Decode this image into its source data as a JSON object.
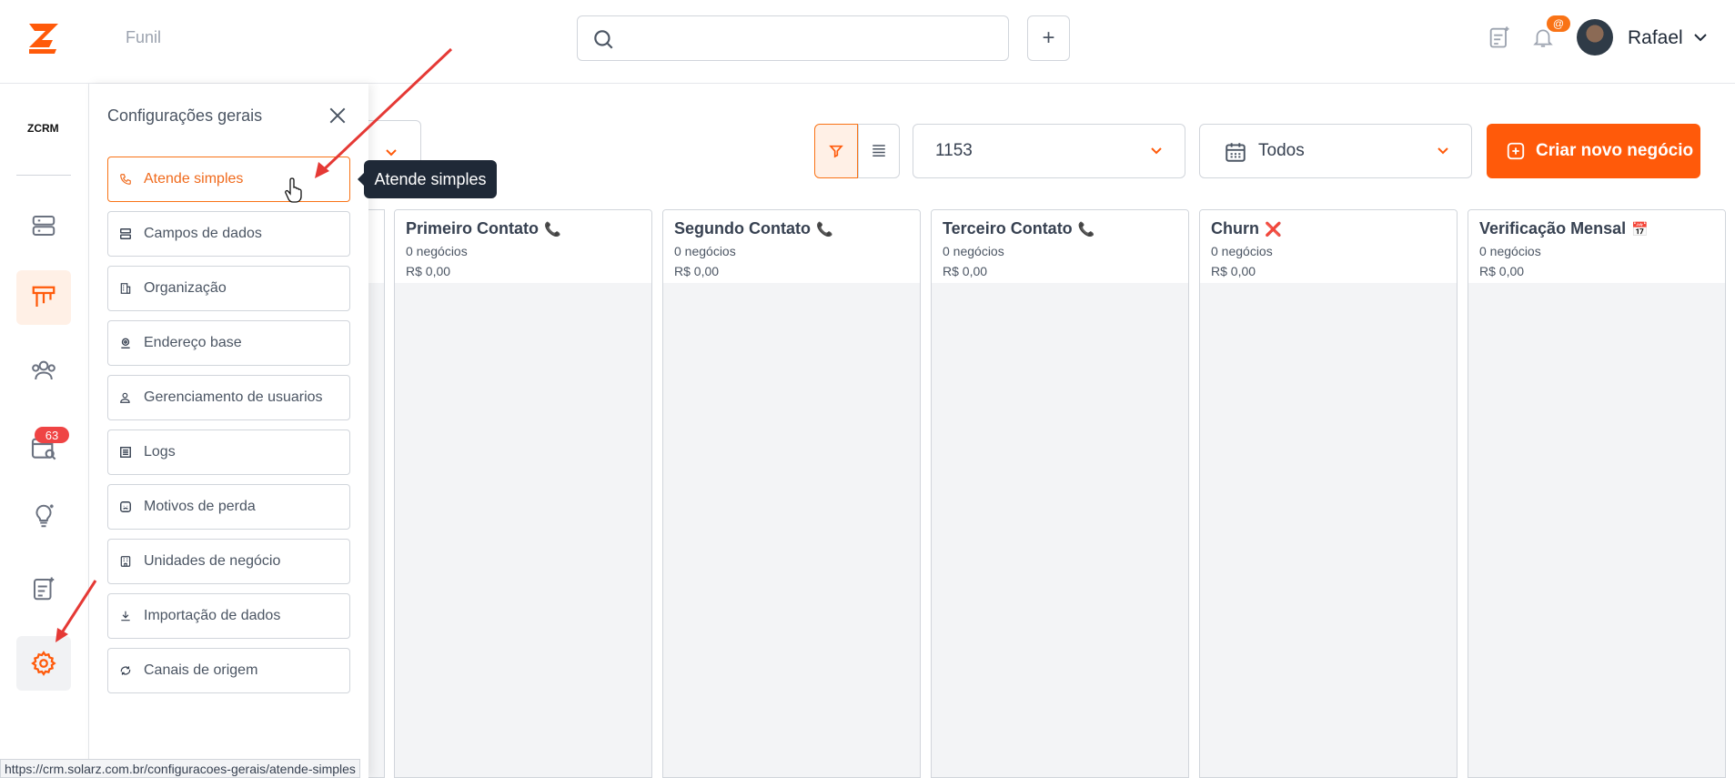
{
  "header": {
    "breadcrumb": "Funil",
    "search_placeholder": "",
    "add_label": "+",
    "mention_badge": "@",
    "user_name": "Rafael"
  },
  "rail": {
    "brand": "ZCRM",
    "notifications_count": "63"
  },
  "settings_panel": {
    "title": "Configurações gerais",
    "items": [
      {
        "label": "Atende simples",
        "icon": "phone-icon",
        "active": true
      },
      {
        "label": "Campos de dados",
        "icon": "database-icon"
      },
      {
        "label": "Organização",
        "icon": "building-icon"
      },
      {
        "label": "Endereço base",
        "icon": "map-pin-icon"
      },
      {
        "label": "Gerenciamento de usuarios",
        "icon": "user-icon"
      },
      {
        "label": "Logs",
        "icon": "list-icon"
      },
      {
        "label": "Motivos de perda",
        "icon": "sad-face-icon"
      },
      {
        "label": "Unidades de negócio",
        "icon": "office-icon"
      },
      {
        "label": "Importação de dados",
        "icon": "download-icon"
      },
      {
        "label": "Canais de origem",
        "icon": "source-channel-icon"
      }
    ]
  },
  "tooltip": "Atende simples",
  "toolbar": {
    "pipeline_value": "1153",
    "period_value": "Todos",
    "create_label": "Criar novo negócio"
  },
  "columns": [
    {
      "title": "Primeiro Contato",
      "emoji": "📞",
      "deals": "0 negócios",
      "value": "R$ 0,00"
    },
    {
      "title": "Segundo Contato",
      "emoji": "📞",
      "deals": "0 negócios",
      "value": "R$ 0,00"
    },
    {
      "title": "Terceiro Contato",
      "emoji": "📞",
      "deals": "0 negócios",
      "value": "R$ 0,00"
    },
    {
      "title": "Churn",
      "emoji": "❌",
      "deals": "0 negócios",
      "value": "R$ 0,00"
    },
    {
      "title": "Verificação Mensal",
      "emoji": "📅",
      "deals": "0 negócios",
      "value": "R$ 0,00"
    }
  ],
  "status_url": "https://crm.solarz.com.br/configuracoes-gerais/atende-simples",
  "colors": {
    "accent": "#ff5a0a",
    "accent_light": "#fff0e6",
    "badge_red": "#ef4444"
  }
}
